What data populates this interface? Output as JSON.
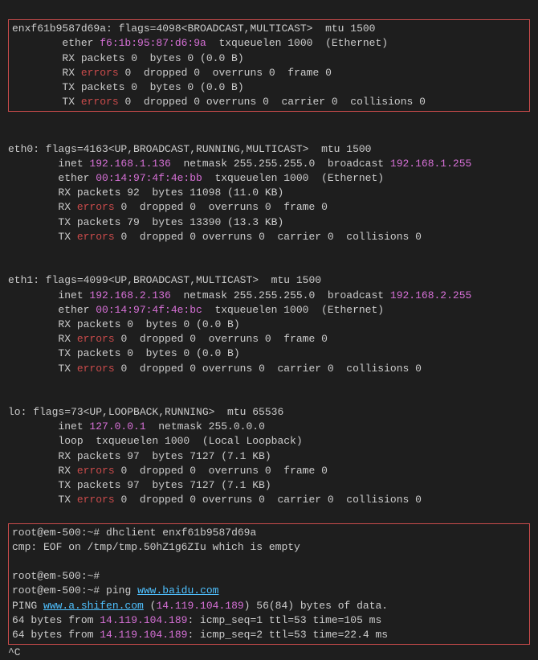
{
  "iface1": {
    "name": "enxf61b9587d69a",
    "flags": ": flags=4098<BROADCAST,MULTICAST>  mtu 1500",
    "ether_label": "        ether ",
    "ether_mac": "f6:1b:95:87:d6:9a",
    "ether_rest": "  txqueuelen 1000  (Ethernet)",
    "rx_packets": "        RX packets 0  bytes 0 (0.0 B)",
    "rx_err_pre": "        RX ",
    "rx_err_word": "errors",
    "rx_err_rest": " 0  dropped 0  overruns 0  frame 0",
    "tx_packets": "        TX packets 0  bytes 0 (0.0 B)",
    "tx_err_pre": "        TX ",
    "tx_err_word": "errors",
    "tx_err_rest": " 0  dropped 0 overruns 0  carrier 0  collisions 0"
  },
  "iface2": {
    "name": "eth0: flags=4163<UP,BROADCAST,RUNNING,MULTICAST>  mtu 1500",
    "inet_pre": "        inet ",
    "inet_ip": "192.168.1.136",
    "inet_mid": "  netmask 255.255.255.0  broadcast ",
    "inet_bcast": "192.168.1.255",
    "ether_pre": "        ether ",
    "ether_mac": "00:14:97:4f:4e:bb",
    "ether_rest": "  txqueuelen 1000  (Ethernet)",
    "rx_packets": "        RX packets 92  bytes 11098 (11.0 KB)",
    "rx_err_pre": "        RX ",
    "rx_err_word": "errors",
    "rx_err_rest": " 0  dropped 0  overruns 0  frame 0",
    "tx_packets": "        TX packets 79  bytes 13390 (13.3 KB)",
    "tx_err_pre": "        TX ",
    "tx_err_word": "errors",
    "tx_err_rest": " 0  dropped 0 overruns 0  carrier 0  collisions 0"
  },
  "iface3": {
    "name": "eth1: flags=4099<UP,BROADCAST,MULTICAST>  mtu 1500",
    "inet_pre": "        inet ",
    "inet_ip": "192.168.2.136",
    "inet_mid": "  netmask 255.255.255.0  broadcast ",
    "inet_bcast": "192.168.2.255",
    "ether_pre": "        ether ",
    "ether_mac": "00:14:97:4f:4e:bc",
    "ether_rest": "  txqueuelen 1000  (Ethernet)",
    "rx_packets": "        RX packets 0  bytes 0 (0.0 B)",
    "rx_err_pre": "        RX ",
    "rx_err_word": "errors",
    "rx_err_rest": " 0  dropped 0  overruns 0  frame 0",
    "tx_packets": "        TX packets 0  bytes 0 (0.0 B)",
    "tx_err_pre": "        TX ",
    "tx_err_word": "errors",
    "tx_err_rest": " 0  dropped 0 overruns 0  carrier 0  collisions 0"
  },
  "iface4": {
    "name": "lo: flags=73<UP,LOOPBACK,RUNNING>  mtu 65536",
    "inet_pre": "        inet ",
    "inet_ip": "127.0.0.1",
    "inet_rest": "  netmask 255.0.0.0",
    "loop": "        loop  txqueuelen 1000  (Local Loopback)",
    "rx_packets": "        RX packets 97  bytes 7127 (7.1 KB)",
    "rx_err_pre": "        RX ",
    "rx_err_word": "errors",
    "rx_err_rest": " 0  dropped 0  overruns 0  frame 0",
    "tx_packets": "        TX packets 97  bytes 7127 (7.1 KB)",
    "tx_err_pre": "        TX ",
    "tx_err_word": "errors",
    "tx_err_rest": " 0  dropped 0 overruns 0  carrier 0  collisions 0"
  },
  "cmds": {
    "prompt1": "root@em-500",
    "tilde": ":~# ",
    "cmd1": "dhclient enxf61b9587d69a",
    "cmp_out": "cmp: EOF on /tmp/tmp.50hZ1g6ZIu which is empty",
    "blank": "",
    "prompt2": "root@em-500",
    "prompt3": "root@em-500",
    "cmd2_pre": "ping ",
    "cmd2_host": "www.baidu.com",
    "ping_line_pre": "PING ",
    "ping_host": "www.a.shifen.com",
    "ping_paren": " (",
    "ping_ip": "14.119.104.189",
    "ping_rest": ") 56(84) bytes of data.",
    "reply1_pre": "64 bytes from ",
    "reply1_ip": "14.119.104.189",
    "reply1_rest": ": icmp_seq=1 ttl=53 time=105 ms",
    "reply2_pre": "64 bytes from ",
    "reply2_ip": "14.119.104.189",
    "reply2_rest": ": icmp_seq=2 ttl=53 time=22.4 ms",
    "ctrlc": "^C"
  }
}
